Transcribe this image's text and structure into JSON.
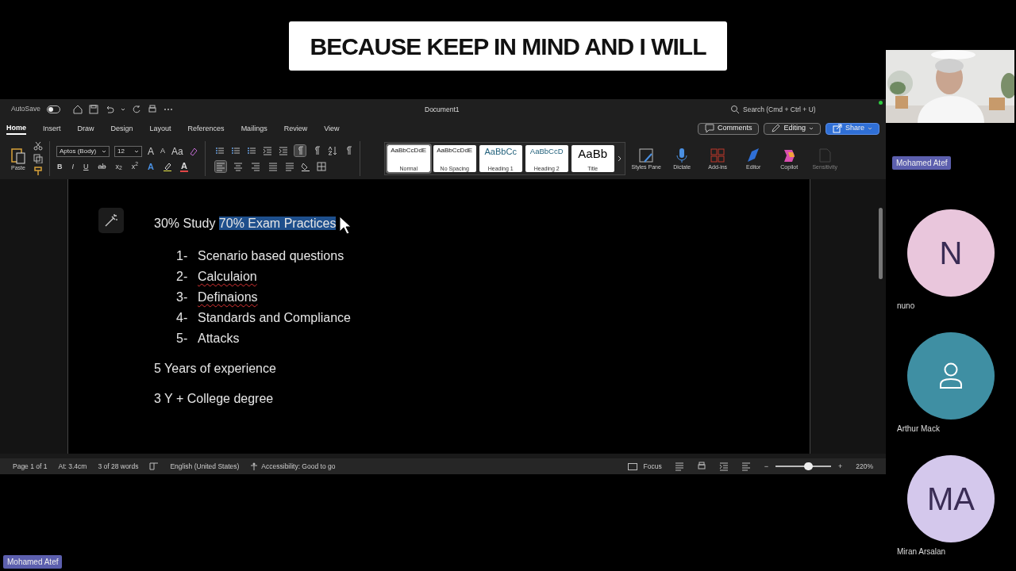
{
  "caption": "BECAUSE KEEP IN MIND AND I WILL",
  "word": {
    "title_bar": {
      "autosave": {
        "label": "AutoSave",
        "on": false
      },
      "document_title": "Document1",
      "search_placeholder": "Search (Cmd + Ctrl + U)"
    },
    "tabs": [
      {
        "label": "Home",
        "selected": true
      },
      {
        "label": "Insert",
        "selected": false
      },
      {
        "label": "Draw",
        "selected": false
      },
      {
        "label": "Design",
        "selected": false
      },
      {
        "label": "Layout",
        "selected": false
      },
      {
        "label": "References",
        "selected": false
      },
      {
        "label": "Mailings",
        "selected": false
      },
      {
        "label": "Review",
        "selected": false
      },
      {
        "label": "View",
        "selected": false
      }
    ],
    "header_buttons": [
      {
        "label": "Comments",
        "kind": "comments"
      },
      {
        "label": "Editing",
        "kind": "editing"
      },
      {
        "label": "Share",
        "kind": "share"
      }
    ],
    "ribbon": {
      "paste_label": "Paste",
      "font_name": "Aptos (Body)",
      "font_size": "12",
      "font_tools": [
        "A",
        "A",
        "Aa"
      ],
      "format_tools": [
        "B",
        "I",
        "U",
        "ab",
        "x$_{2}$",
        "x$^{2}$"
      ],
      "color_tools": [
        "A",
        "A"
      ],
      "show_marks_on": true,
      "alignments": [
        {
          "kind": "left",
          "selected": true
        },
        {
          "kind": "center",
          "selected": false
        },
        {
          "kind": "right",
          "selected": false
        },
        {
          "kind": "justify",
          "selected": false
        }
      ],
      "styles": [
        {
          "preview": "AaBbCcDdE",
          "name": "Normal",
          "kind": "normal",
          "selected": true
        },
        {
          "preview": "AaBbCcDdE",
          "name": "No Spacing",
          "kind": "normal",
          "selected": false
        },
        {
          "preview": "AaBbCc",
          "name": "Heading 1",
          "kind": "heading1",
          "selected": false
        },
        {
          "preview": "AaBbCcD",
          "name": "Heading 2",
          "kind": "heading2",
          "selected": false
        },
        {
          "preview": "AaBb",
          "name": "Title",
          "kind": "title",
          "selected": false
        }
      ],
      "tools": [
        {
          "label": "Styles Pane",
          "kind": "styles",
          "disabled": false
        },
        {
          "label": "Dictate",
          "kind": "dictate",
          "disabled": false
        },
        {
          "label": "Add-ins",
          "kind": "addins",
          "disabled": false
        },
        {
          "label": "Editor",
          "kind": "editor",
          "disabled": false
        },
        {
          "label": "Copilot",
          "kind": "copilot",
          "disabled": false
        },
        {
          "label": "Sensitivity",
          "kind": "sensitivity",
          "disabled": true
        }
      ]
    },
    "document": [
      {
        "kind": "paragraph",
        "runs": [
          {
            "text": "30% Study ",
            "highlighted": false
          },
          {
            "text": "70% Exam Practices",
            "highlighted": true
          }
        ]
      },
      {
        "kind": "list",
        "items": [
          {
            "number": "1-",
            "text": "Scenario based questions",
            "misspelled": false
          },
          {
            "number": "2-",
            "text": "Calculaion",
            "misspelled": true
          },
          {
            "number": "3-",
            "text": "Definaions",
            "misspelled": true
          },
          {
            "number": "4-",
            "text": "Standards and Compliance",
            "misspelled": false
          },
          {
            "number": "5-",
            "text": "Attacks",
            "misspelled": false
          }
        ]
      },
      {
        "kind": "paragraph",
        "runs": [
          {
            "text": "5 Years of experience",
            "highlighted": false
          }
        ]
      },
      {
        "kind": "paragraph",
        "runs": [
          {
            "text": "3 Y + College degree",
            "highlighted": false
          }
        ]
      }
    ],
    "status_bar": {
      "items": [
        "Page 1 of 1",
        "At: 3.4cm",
        "3 of 28 words"
      ],
      "language": "English (United States)",
      "accessibility": "Accessibility: Good to go",
      "focus": "Focus",
      "zoom_minus": "−",
      "zoom_plus": "+",
      "zoom": {
        "level": 0.59
      },
      "zoom_reading": "220%"
    }
  },
  "participants": [
    {
      "name": "Mohamed Atef",
      "kind": "video"
    },
    {
      "name": "nuno",
      "kind": "initials",
      "initials": "N",
      "color": "#e9c6dc"
    },
    {
      "name": "Arthur Mack",
      "kind": "silhouette",
      "color": "#3f8fa3"
    },
    {
      "name": "Miran Arsalan",
      "kind": "initials",
      "initials": "MA",
      "color": "#d4c8ec"
    }
  ],
  "presenter_tag": "Mohamed Atef"
}
